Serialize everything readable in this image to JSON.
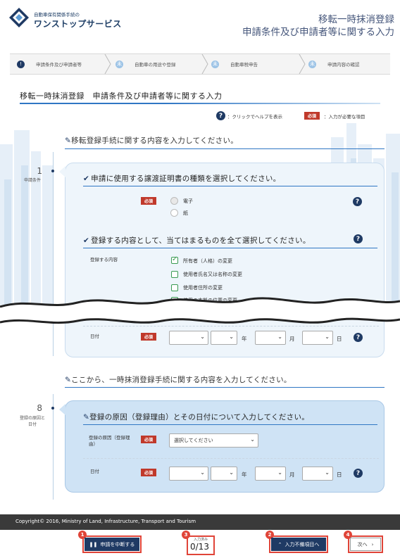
{
  "header": {
    "logo_sub": "自動車保有関係手続の",
    "logo_main": "ワンストップサービス",
    "title_line1": "移転一時抹消登録",
    "title_line2": "申請条件及び申請者等に関する入力"
  },
  "steps": [
    {
      "icon": "!",
      "label": "申請条件及び申請者等",
      "state": "current"
    },
    {
      "icon": "未",
      "label": "自動車の用途や登録",
      "state": "todo"
    },
    {
      "icon": "未",
      "label": "自動車税申告",
      "state": "todo"
    },
    {
      "icon": "未",
      "label": "申請内容の確認",
      "state": "todo"
    }
  ],
  "page_title": "移転一時抹消登録　申請条件及び申請者等に関する入力",
  "legend": {
    "help_icon": "?",
    "help_text": "：クリックでヘルプを表示",
    "required_badge": "必須",
    "required_text": "：入力が必要な項目"
  },
  "section1": {
    "heading": "移転登録手続に関する内容を入力してください。",
    "rail_number": "1",
    "rail_label": "申請条件",
    "q1": {
      "title": "申請に使用する譲渡証明書の種類を選択してください。",
      "required": "必須",
      "options": [
        "電子",
        "紙"
      ]
    },
    "q2": {
      "title": "登録する内容として、当てはまるものを全て選択してください。",
      "field_label": "登録する内容",
      "options": [
        {
          "label": "所有者（人格）の変更",
          "checked": true
        },
        {
          "label": "使用者氏名又は名称の変更",
          "checked": false
        },
        {
          "label": "使用者住所の変更",
          "checked": false
        },
        {
          "label": "使用の本拠の位置の変更",
          "checked": false
        }
      ]
    },
    "date": {
      "label": "日付",
      "required": "必須",
      "units": [
        "年",
        "月",
        "日"
      ]
    }
  },
  "section2": {
    "heading": "ここから、一時抹消登録手続に関する内容を入力してください。",
    "rail_number": "8",
    "rail_label": "登録の原因と日付",
    "q": {
      "title": "登録の原因（登録理由）とその日付について入力してください。",
      "reason_label": "登録の原因（登録理由）",
      "reason_required": "必須",
      "reason_value": "選択してください",
      "date_label": "日付",
      "date_required": "必須",
      "units": [
        "年",
        "月",
        "日"
      ]
    }
  },
  "footer": {
    "copyright": "Copyright© 2016, Ministry of Land, Infrastructure, Transport and Tourism"
  },
  "bottom": {
    "suspend_label": "申請を中断する",
    "counter_label": "入力済み",
    "counter_value": "0/13",
    "incomplete_label": "入力不備項目へ",
    "next_label": "次へ",
    "badges": [
      "1",
      "3",
      "2",
      "4"
    ]
  },
  "colors": {
    "primary": "#1f3a64",
    "accent_blue": "#2f76c4",
    "required_red": "#c0392b",
    "highlight_red": "#e04438",
    "check_green": "#3a9a52"
  }
}
